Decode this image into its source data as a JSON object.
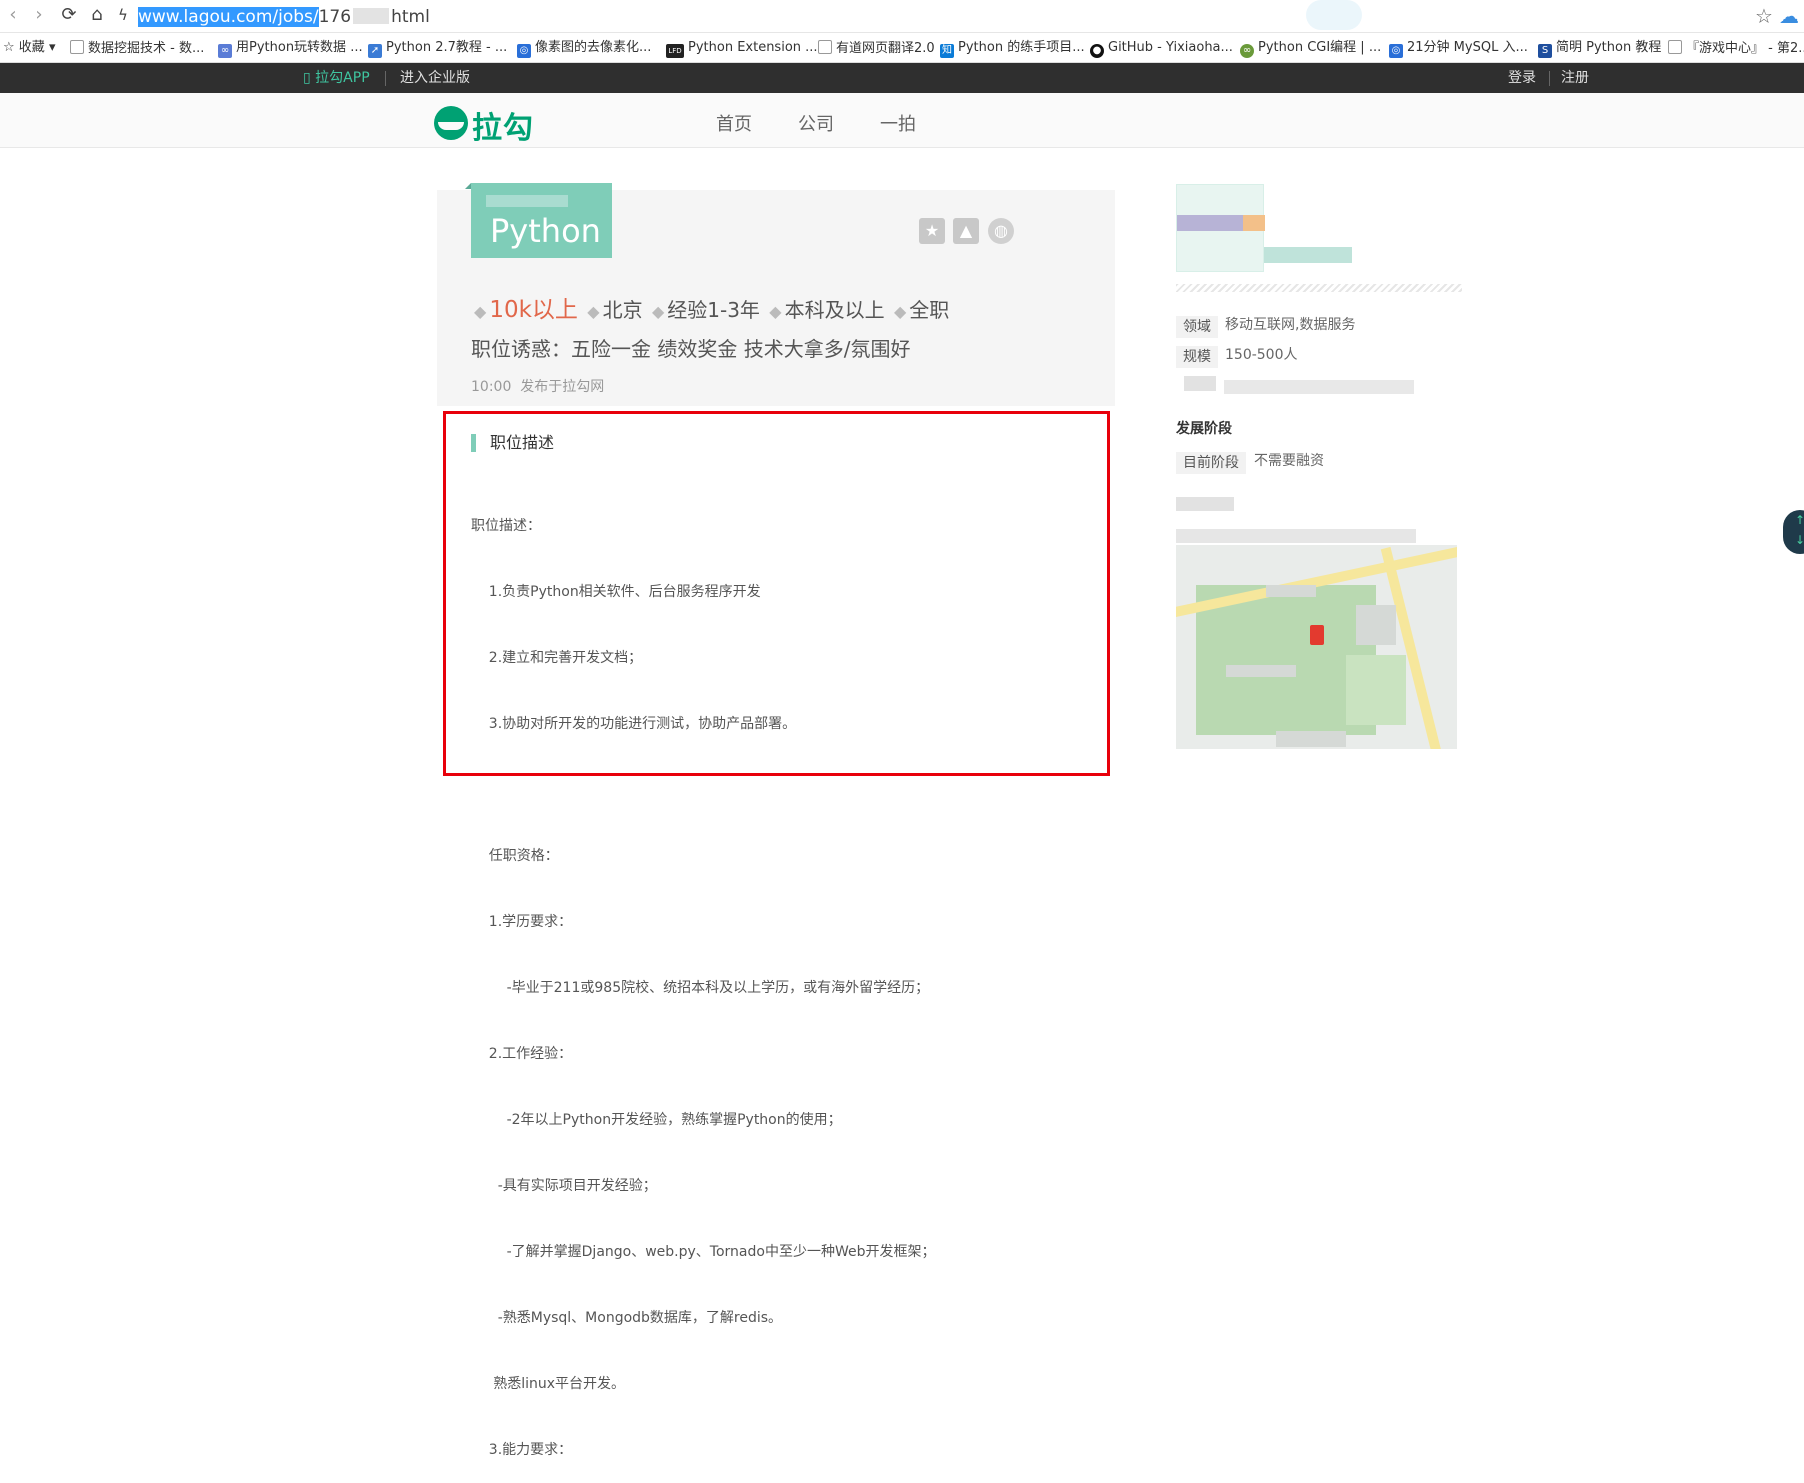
{
  "browser": {
    "url_selected": "www.lagou.com/jobs/",
    "url_prefix": "176",
    "url_suffix": "html",
    "icons": [
      "back-icon",
      "forward-icon",
      "reload-icon",
      "home-icon",
      "bolt-icon",
      "star-icon",
      "cloud-icon"
    ]
  },
  "bookmarks": {
    "fav_label": "收藏",
    "items": [
      {
        "label": "数据挖掘技术 - 数..."
      },
      {
        "label": "用Python玩转数据 ..."
      },
      {
        "label": "Python 2.7教程 - ..."
      },
      {
        "label": "像素图的去像素化..."
      },
      {
        "label": "Python Extension ..."
      },
      {
        "label": "有道网页翻译2.0"
      },
      {
        "label": "Python 的练手项目..."
      },
      {
        "label": "GitHub - Yixiaoha..."
      },
      {
        "label": "Python CGI编程 | ..."
      },
      {
        "label": "21分钟 MySQL 入..."
      },
      {
        "label": "简明 Python 教程"
      },
      {
        "label": "『游戏中心』 - 第2..."
      }
    ]
  },
  "topbar": {
    "app_label": "拉勾APP",
    "enterprise_label": "进入企业版",
    "login_label": "登录",
    "register_label": "注册"
  },
  "header": {
    "logo_text": "拉勾",
    "nav": [
      {
        "label": "首页"
      },
      {
        "label": "公司"
      },
      {
        "label": "一拍"
      }
    ]
  },
  "job": {
    "title": "Python",
    "salary": "10k以上",
    "city": "北京",
    "experience": "经验1-3年",
    "education": "本科及以上",
    "type": "全职",
    "perks": "职位诱惑：五险一金 绩效奖金 技术大拿多/氛围好",
    "publish_time": "10:00",
    "publish_source": "发布于拉勾网",
    "description_heading": "职位描述",
    "description_lines": [
      "职位描述：",
      "    1.负责Python相关软件、后台服务程序开发",
      "    2.建立和完善开发文档；",
      "    3.协助对所开发的功能进行测试，协助产品部署。",
      "",
      "    任职资格：",
      "    1.学历要求：",
      "        -毕业于211或985院校、统招本科及以上学历，或有海外留学经历；",
      "    2.工作经验：",
      "        -2年以上Python开发经验，熟练掌握Python的使用；",
      "      -具有实际项目开发经验；",
      "        -了解并掌握Django、web.py、Tornado中至少一种Web开发框架；",
      "      -熟悉Mysql、Mongodb数据库，了解redis。",
      "     熟悉linux平台开发。",
      "    3.能力要求："
    ]
  },
  "company": {
    "field_label": "领域",
    "field_value": "移动互联网,数据服务",
    "scale_label": "规模",
    "scale_value": "150-500人",
    "stage_title": "发展阶段",
    "stage_label": "目前阶段",
    "stage_value": "不需要融资"
  },
  "colors": {
    "brand": "#00a173",
    "tag_bg": "#7fcdb8",
    "salary": "#e1674a",
    "highlight_border": "#e8000b"
  }
}
